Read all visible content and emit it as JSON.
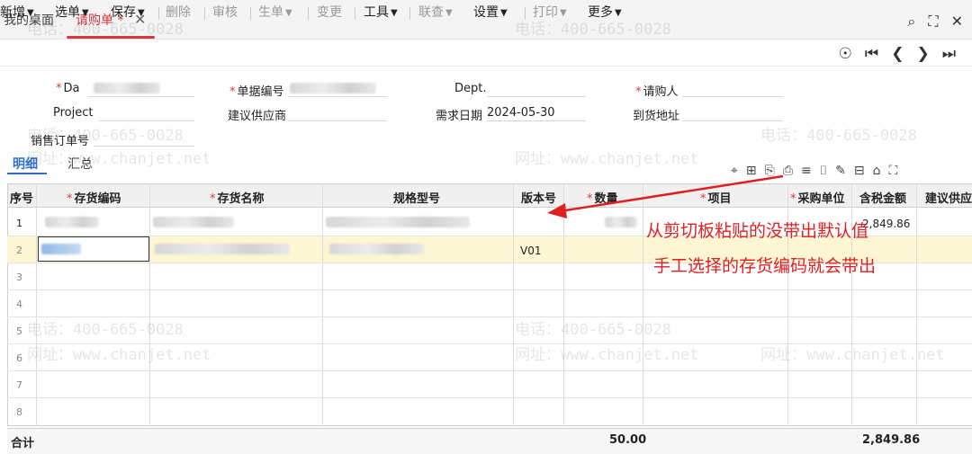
{
  "tabs": {
    "home": "我的桌面",
    "active": "请购单 *",
    "close": "✕"
  },
  "toolbar": {
    "new": "新增",
    "select": "选单",
    "save": "保存",
    "delete": "删除",
    "audit": "审核",
    "generate": "生单",
    "change": "变更",
    "tools": "工具",
    "query": "联查",
    "settings": "设置",
    "print": "打印",
    "more": "更多"
  },
  "form": {
    "date_label": "Da",
    "doc_no_label": "单据编号",
    "dept_label": "Dept.",
    "requester_label": "请购人",
    "project_label": "Project",
    "supplier_label": "建议供应商",
    "need_date_label": "需求日期",
    "need_date_value": "2024-05-30",
    "address_label": "到货地址",
    "sales_order_label": "销售订单号"
  },
  "subtabs": {
    "detail": "明细",
    "summary": "汇总"
  },
  "grid": {
    "headers": {
      "seq": "序号",
      "inv_code": "存货编码",
      "inv_name": "存货名称",
      "spec": "规格型号",
      "version": "版本号",
      "qty": "数量",
      "item": "项目",
      "unit": "采购单位",
      "amount": "含税金额",
      "supplier": "建议供应"
    },
    "row_numbers": [
      "1",
      "2",
      "3",
      "4",
      "5",
      "6",
      "7",
      "8"
    ],
    "row1_amount": "2,849.86",
    "row2_version": "V01",
    "total_label": "合计",
    "total_qty": "50.00",
    "total_amount": "2,849.86"
  },
  "annotation": {
    "line1": "从剪切板粘贴的没带出默认值",
    "line2": "手工选择的存货编码就会带出",
    "color": "#e02020"
  },
  "watermark": {
    "phone": "电话：400-665-0028",
    "site": "网址：www.chanjet.net"
  },
  "colors": {
    "accent_red": "#d9363e",
    "link_blue": "#2f6fc8",
    "highlight_row": "#fdf6d2"
  }
}
